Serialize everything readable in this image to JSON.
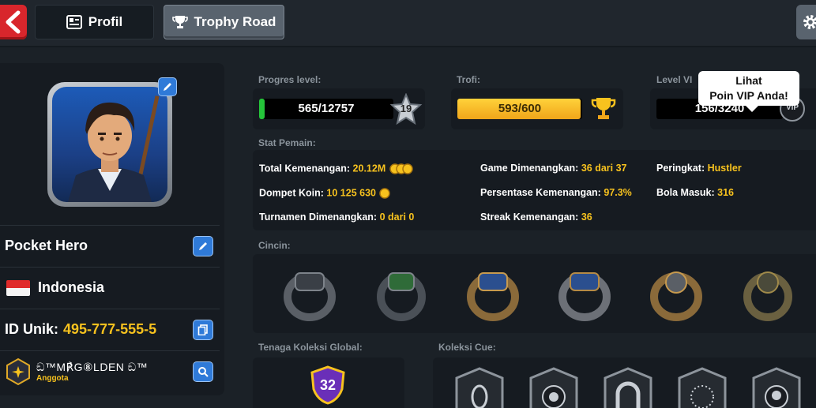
{
  "tabs": {
    "profil": "Profil",
    "trophy_road": "Trophy Road"
  },
  "player": {
    "name": "Pocket Hero",
    "country": "Indonesia",
    "id_label": "ID Unik:",
    "id_value": "495-777-555-5",
    "club_name": "ඞ™M℟G⑧LDEN ඞ™",
    "club_role": "Anggota"
  },
  "progress": {
    "level_label": "Progres level:",
    "level_value": "565/12757",
    "level_number": "19",
    "level_fraction": 0.044,
    "trophy_label": "Trofi:",
    "trophy_value": "593/600",
    "trophy_fraction": 0.988,
    "vip_label": "Level VI",
    "vip_value": "156/3240",
    "vip_badge": "VIP",
    "tooltip_line1": "Lihat",
    "tooltip_line2": "Poin VIP Anda!"
  },
  "stats": {
    "label": "Stat Pemain:",
    "total_wins_label": "Total Kemenangan:",
    "total_wins_value": "20.12M",
    "coin_wallet_label": "Dompet Koin:",
    "coin_wallet_value": "10 125 630",
    "tournaments_label": "Turnamen Dimenangkan:",
    "tournaments_value": "0 dari 0",
    "games_won_label": "Game Dimenangkan:",
    "games_won_value": "36 dari 37",
    "win_pct_label": "Persentase Kemenangan:",
    "win_pct_value": "97.3%",
    "streak_label": "Streak Kemenangan:",
    "streak_value": "36",
    "rank_label": "Peringkat:",
    "rank_value": "Hustler",
    "balls_label": "Bola Masuk:",
    "balls_value": "316"
  },
  "rings": {
    "label": "Cincin:",
    "items": [
      "ring-1",
      "ring-2",
      "ring-3",
      "ring-4",
      "ring-5",
      "ring-6"
    ]
  },
  "global": {
    "label": "Tenaga Koleksi Global:",
    "value": "32"
  },
  "cue": {
    "label": "Koleksi Cue:"
  },
  "colors": {
    "accent_yellow": "#f7c21e",
    "accent_blue": "#2f7ad8",
    "back_red": "#d8262c",
    "level_green": "#25c43a"
  }
}
